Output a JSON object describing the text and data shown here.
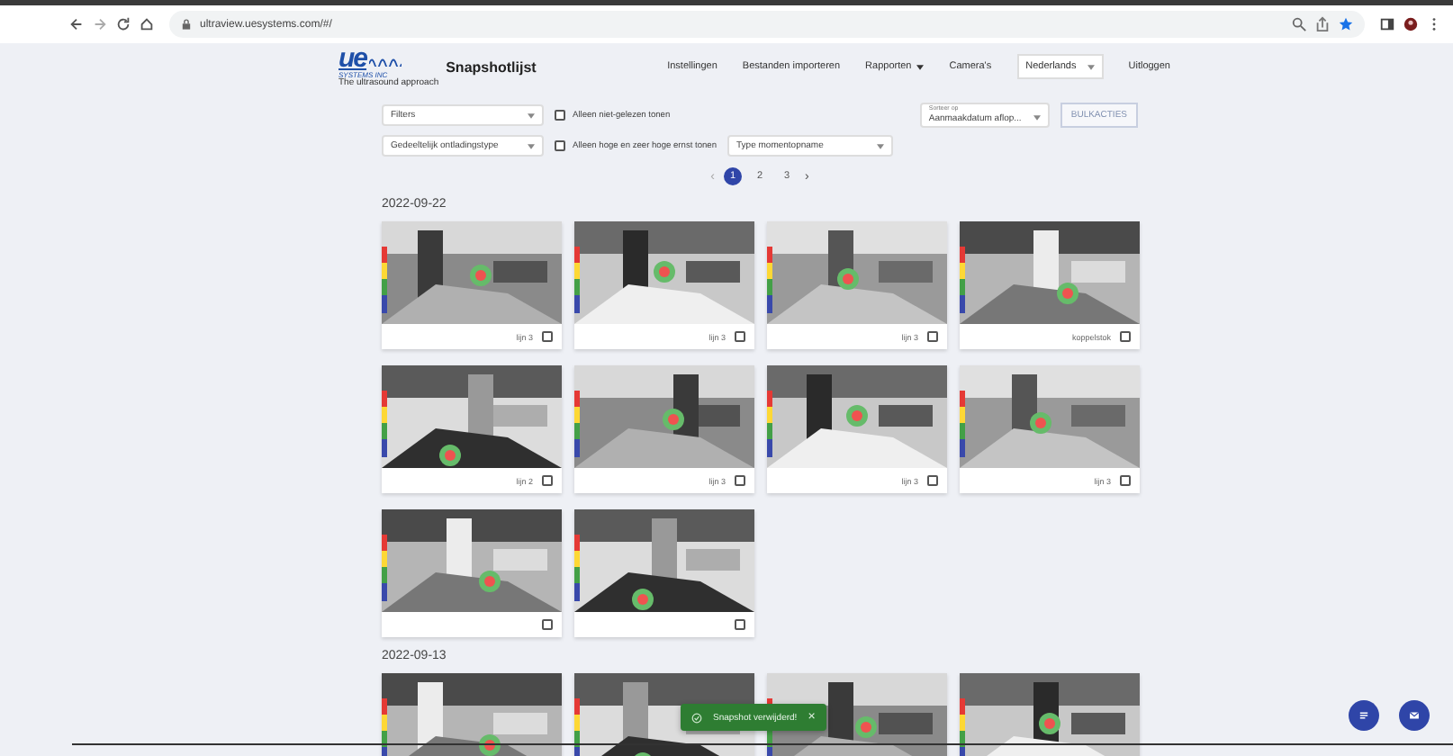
{
  "browser": {
    "url": "ultraview.uesystems.com/#/"
  },
  "header": {
    "logo": {
      "mark": "ue",
      "company": "SYSTEMS INC",
      "tagline": "The ultrasound approach"
    },
    "title": "Snapshotlijst",
    "nav": [
      {
        "kind": "link",
        "label": "Instellingen"
      },
      {
        "kind": "link",
        "label": "Bestanden importeren"
      },
      {
        "kind": "menu",
        "label": "Rapporten"
      },
      {
        "kind": "link",
        "label": "Camera's"
      },
      {
        "kind": "select",
        "label": "Nederlands"
      },
      {
        "kind": "link",
        "label": "Uitloggen"
      }
    ]
  },
  "filters": {
    "filter_select": "Filters",
    "unread_only": {
      "label": "Alleen niet-gelezen tonen",
      "checked": false
    },
    "discharge_type": "Gedeeltelijk ontladingstype",
    "severity_only": {
      "label": "Alleen hoge en zeer hoge ernst tonen",
      "checked": false
    },
    "snapshot_type": "Type momentopname",
    "sort": {
      "label": "Sorteer op",
      "value": "Aanmaakdatum aflop..."
    },
    "bulk_button": "BULKACTIES"
  },
  "pagination": {
    "prev": "‹",
    "next": "›",
    "pages": [
      {
        "label": "1",
        "selected": true
      },
      {
        "label": "2",
        "selected": false
      },
      {
        "label": "3",
        "selected": false
      }
    ]
  },
  "groups": [
    {
      "date": "2022-09-22",
      "cards": [
        {
          "kind": "labeled",
          "label": "lijn 3",
          "checked": false
        },
        {
          "kind": "labeled",
          "label": "lijn 3",
          "checked": false
        },
        {
          "kind": "labeled",
          "label": "lijn 3",
          "checked": false
        },
        {
          "kind": "labeled",
          "label": "koppelstok",
          "checked": false
        },
        {
          "kind": "labeled",
          "label": "lijn 2",
          "checked": false
        },
        {
          "kind": "labeled",
          "label": "lijn 3",
          "checked": false
        },
        {
          "kind": "labeled",
          "label": "lijn 3",
          "checked": false
        },
        {
          "kind": "labeled",
          "label": "lijn 3",
          "checked": false
        },
        {
          "kind": "plain",
          "checked": false
        },
        {
          "kind": "plain",
          "checked": false
        }
      ]
    },
    {
      "date": "2022-09-13",
      "cards": [
        {
          "kind": "cut"
        },
        {
          "kind": "cut"
        },
        {
          "kind": "cut"
        },
        {
          "kind": "cut"
        }
      ]
    }
  ],
  "toast": {
    "message": "Snapshot verwijderd!",
    "close": "×"
  }
}
